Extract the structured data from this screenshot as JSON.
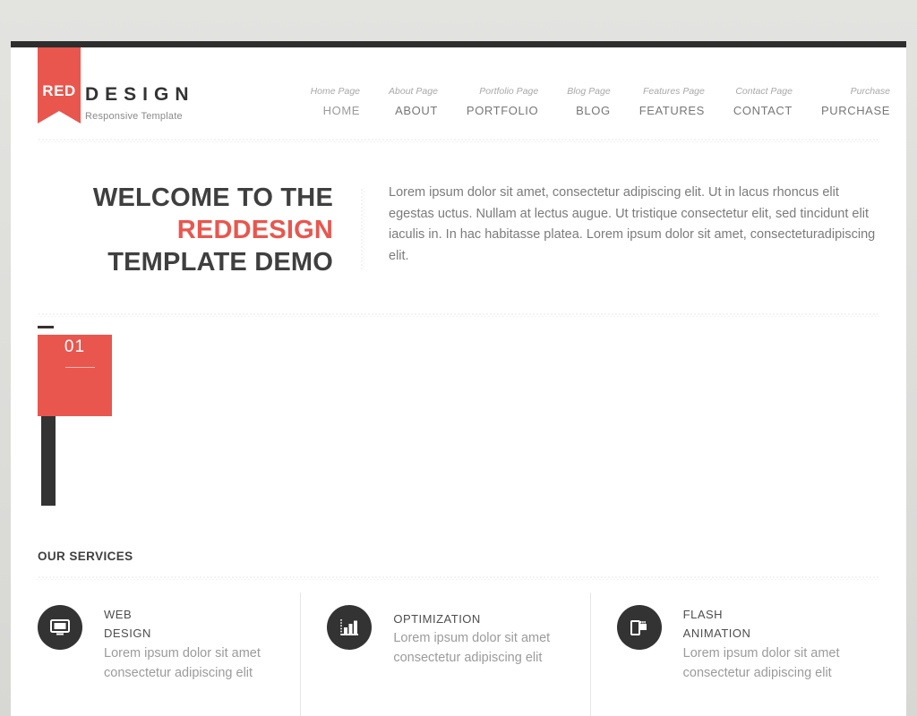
{
  "topbar": {
    "color": "#2e2e2e"
  },
  "brand": {
    "badge": "RED",
    "name": "DESIGN",
    "tagline": "Responsive Template",
    "accent": "#e9564e"
  },
  "nav": {
    "items": [
      {
        "sub": "Home Page",
        "label": "HOME",
        "active": true
      },
      {
        "sub": "About Page",
        "label": "ABOUT",
        "active": false
      },
      {
        "sub": "Portfolio Page",
        "label": "PORTFOLIO",
        "active": false
      },
      {
        "sub": "Blog Page",
        "label": "BLOG",
        "active": false
      },
      {
        "sub": "Features Page",
        "label": "FEATURES",
        "active": false
      },
      {
        "sub": "Contact Page",
        "label": "CONTACT",
        "active": false
      },
      {
        "sub": "Purchase",
        "label": "PURCHASE",
        "active": false
      }
    ]
  },
  "welcome": {
    "line1": "WELCOME TO THE",
    "line2": "REDDESIGN",
    "line3": "TEMPLATE DEMO",
    "paragraph": "Lorem ipsum dolor sit amet, consectetur adipiscing elit. Ut in lacus rhoncus elit egestas uctus. Nullam at lectus augue. Ut tristique consectetur elit, sed tincidunt elit iaculis in. In hac habitasse platea. Lorem ipsum dolor sit amet, consecteturadipiscing elit."
  },
  "slider": {
    "number": "01"
  },
  "services": {
    "title": "OUR SERVICES",
    "items": [
      {
        "icon": "monitor-icon",
        "title_line1": "WEB",
        "title_line2": "DESIGN",
        "desc": "Lorem ipsum dolor sit amet consectetur adipiscing elit"
      },
      {
        "icon": "bar-chart-icon",
        "title_line1": "OPTIMIZATION",
        "title_line2": "",
        "desc": "Lorem ipsum dolor sit amet consectetur adipiscing elit"
      },
      {
        "icon": "film-roll-icon",
        "title_line1": "FLASH",
        "title_line2": "ANIMATION",
        "desc": "Lorem ipsum dolor sit amet consectetur adipiscing elit"
      }
    ]
  }
}
